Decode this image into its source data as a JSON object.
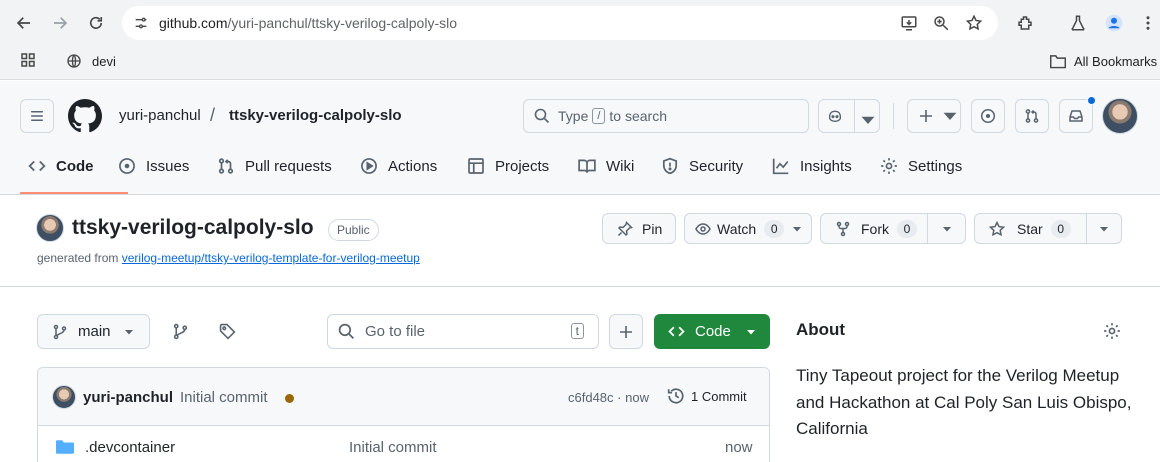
{
  "browser": {
    "url_host": "github.com",
    "url_path": "/yuri-panchul/ttsky-verilog-calpoly-slo",
    "bookmark_devi": "devi",
    "all_bookmarks": "All Bookmarks"
  },
  "header": {
    "owner": "yuri-panchul",
    "separator": "/",
    "repo": "ttsky-verilog-calpoly-slo",
    "search_type": "Type",
    "search_key": "/",
    "search_rest": "to search"
  },
  "tabs": [
    {
      "label": "Code",
      "icon": "code-icon"
    },
    {
      "label": "Issues",
      "icon": "issue-icon"
    },
    {
      "label": "Pull requests",
      "icon": "pull-request-icon"
    },
    {
      "label": "Actions",
      "icon": "play-icon"
    },
    {
      "label": "Projects",
      "icon": "table-icon"
    },
    {
      "label": "Wiki",
      "icon": "book-icon"
    },
    {
      "label": "Security",
      "icon": "shield-icon"
    },
    {
      "label": "Insights",
      "icon": "graph-icon"
    },
    {
      "label": "Settings",
      "icon": "gear-icon"
    }
  ],
  "repo": {
    "name": "ttsky-verilog-calpoly-slo",
    "visibility": "Public",
    "generated_from_label": "generated from",
    "template_link": "verilog-meetup/ttsky-verilog-template-for-verilog-meetup",
    "pin": "Pin",
    "watch": "Watch",
    "watch_count": "0",
    "fork": "Fork",
    "fork_count": "0",
    "star": "Star",
    "star_count": "0"
  },
  "files_bar": {
    "branch": "main",
    "goto_placeholder": "Go to file",
    "goto_key": "t",
    "code_button": "Code"
  },
  "commit": {
    "author": "yuri-panchul",
    "message": "Initial commit",
    "sha": "c6fd48c",
    "time": "· now",
    "count": "1 Commit"
  },
  "files": [
    {
      "name": ".devcontainer",
      "message": "Initial commit",
      "time": "now"
    }
  ],
  "about": {
    "title": "About",
    "description": "Tiny Tapeout project for the Verilog Meetup and Hackathon at Cal Poly San Luis Obispo, California"
  },
  "colors": {
    "accent_green": "#1f883d",
    "link": "#0969da",
    "tab_underline": "#fd8c73"
  }
}
